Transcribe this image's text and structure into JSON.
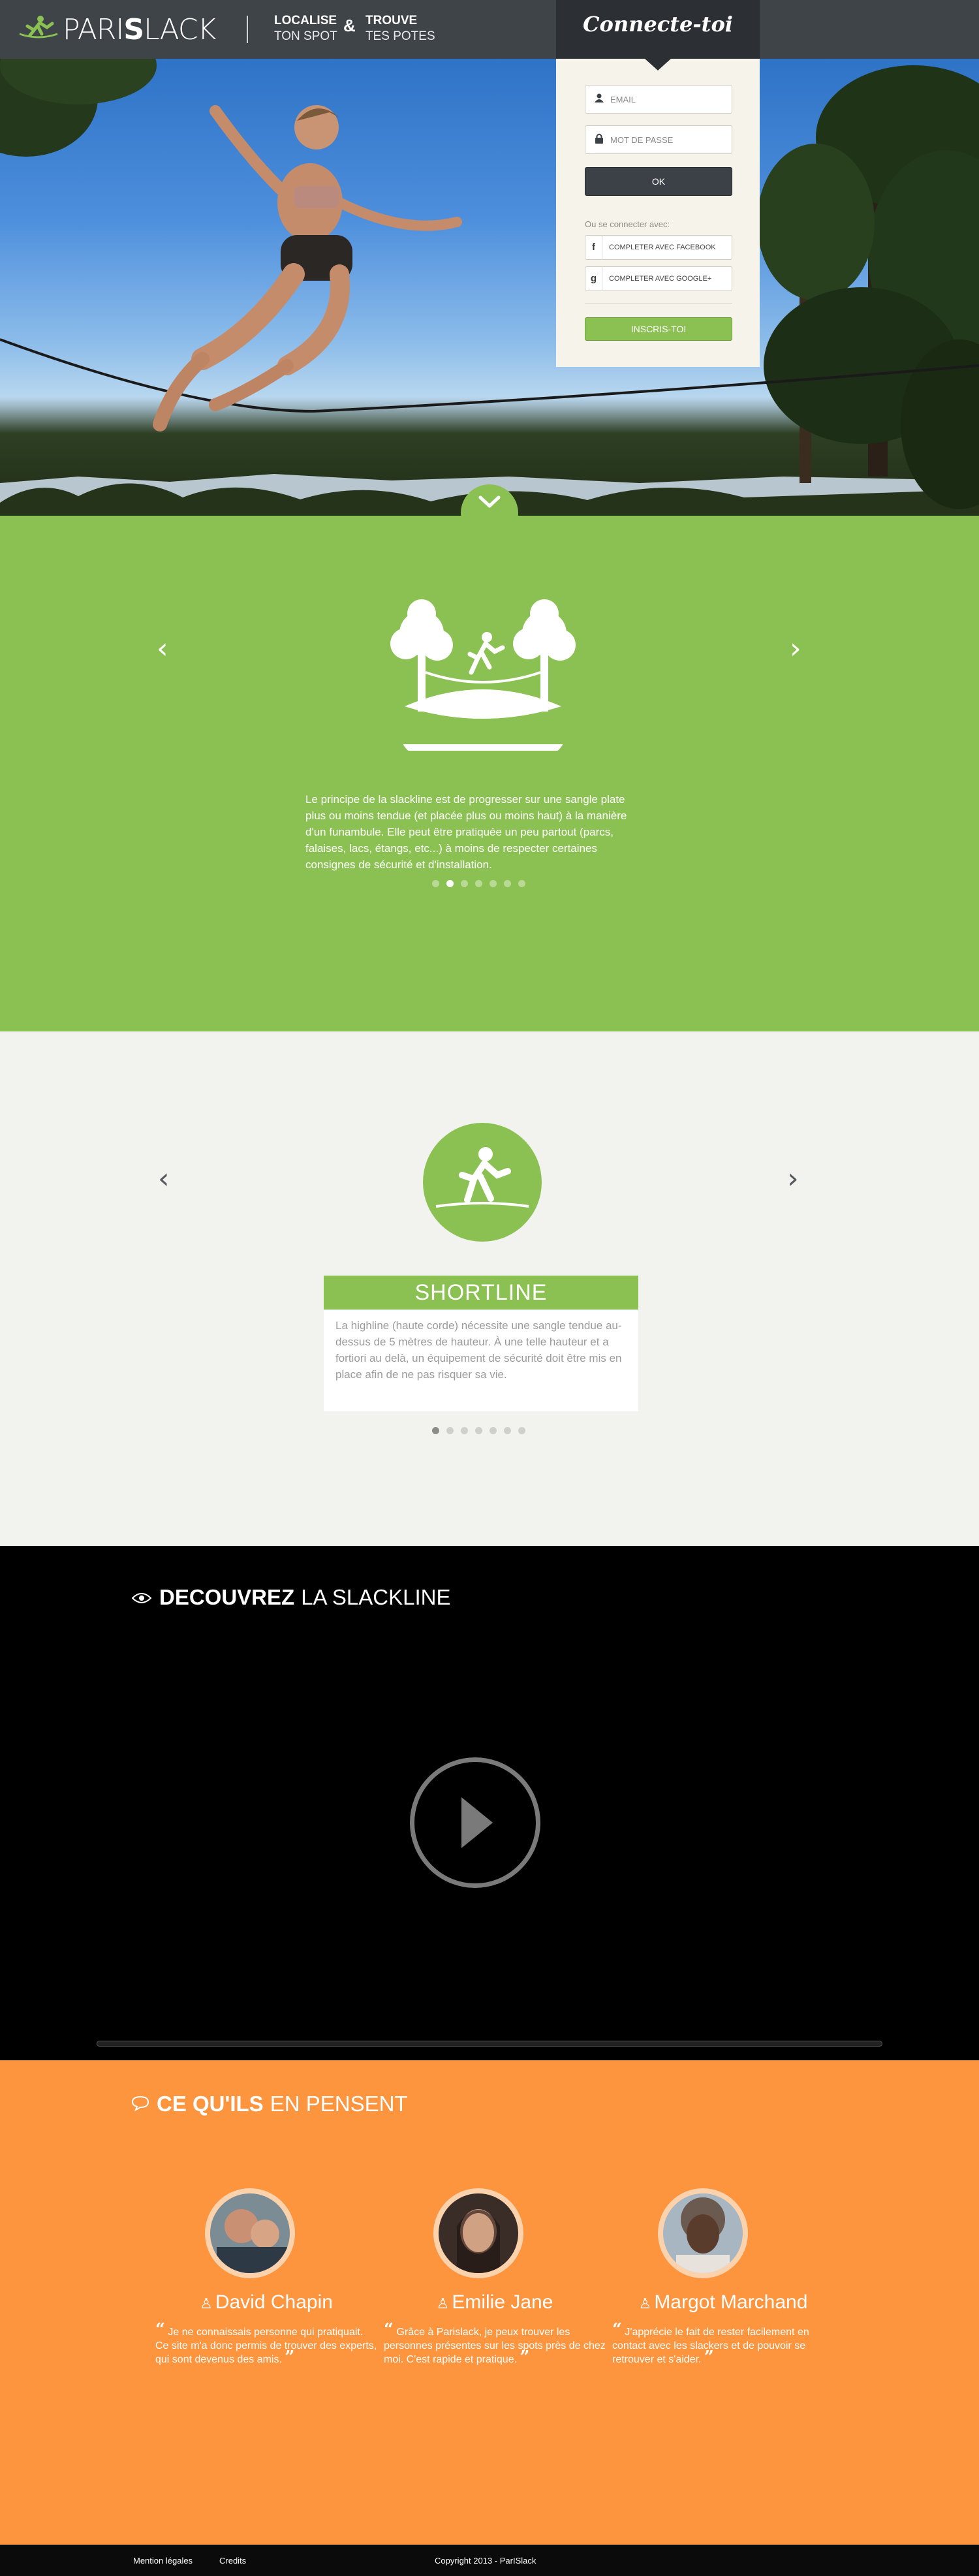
{
  "brand": {
    "logo_part1": "PARI",
    "logo_part2": "S",
    "logo_part3": "LACK",
    "accent_green": "#8bc152",
    "accent_orange": "#fd943e",
    "header_color": "#3f4449"
  },
  "header": {
    "tagline1_bold": "LOCALISE",
    "tagline1_light": "TON SPOT",
    "ampersand": "&",
    "tagline2_bold": "TROUVE",
    "tagline2_light": "TES POTES"
  },
  "login": {
    "title": "Connecte-toi",
    "email_placeholder": "EMAIL",
    "password_placeholder": "MOT DE PASSE",
    "ok_label": "OK",
    "or_label": "Ou se connecter avec:",
    "facebook_label": "COMPLETER AVEC FACEBOOK",
    "google_label": "COMPLETER AVEC GOOGLE+",
    "signup_label": "INSCRIS-TOI",
    "icons": {
      "email": "user-icon",
      "password": "lock-icon",
      "facebook": "facebook-icon",
      "google": "google-icon"
    }
  },
  "intro_slider": {
    "text": "Le principe de la slackline est de progresser sur une sangle plate plus ou moins tendue (et placée plus ou moins haut) à la manière d'un funambule. Elle peut être pratiquée un peu partout (parcs, falaises, lacs, étangs, etc...) à moins de respecter certaines consignes de sécurité et d'installation.",
    "dot_count": 7,
    "active_dot": 1
  },
  "types_slider": {
    "title": "SHORTLINE",
    "text": "La highline (haute corde) nécessite une sangle tendue au-dessus de 5 mètres de hauteur. À une telle hauteur et a fortiori au delà, un équipement de sécurité doit être mis en place afin de ne pas risquer sa vie.",
    "dot_count": 7,
    "active_dot": 0
  },
  "video": {
    "title_bold": "DECOUVREZ",
    "title_rest": "LA SLACKLINE"
  },
  "testimonials": {
    "title_bold": "CE QU'ILS",
    "title_rest": "EN PENSENT",
    "people": [
      {
        "name": "David Chapin",
        "quote": "Je ne connaissais personne qui pratiquait. Ce site m'a donc permis de trouver des experts, qui sont devenus des amis."
      },
      {
        "name": "Emilie Jane",
        "quote": "Grâce à Parislack, je peux trouver les personnes présentes sur les spots près de chez moi. C'est rapide et pratique."
      },
      {
        "name": "Margot Marchand",
        "quote": "J'apprécie le fait de rester facilement en contact avec les slackers et de pouvoir se retrouver et s'aider."
      }
    ]
  },
  "footer": {
    "legal": "Mention légales",
    "credits": "Credits",
    "copyright": "Copyright 2013 - ParISlack"
  }
}
